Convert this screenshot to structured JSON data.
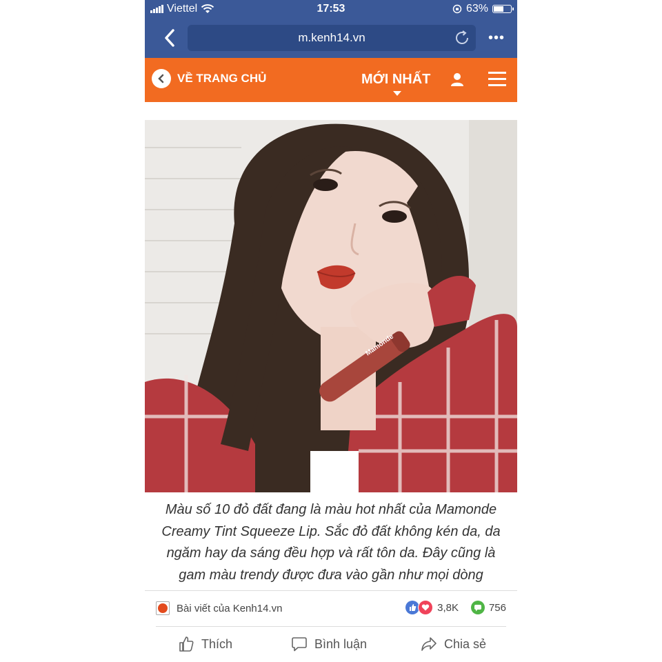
{
  "status_bar": {
    "carrier": "Viettel",
    "time": "17:53",
    "battery_percent": "63%",
    "battery_level": 0.63
  },
  "browser": {
    "url": "m.kenh14.vn"
  },
  "nav": {
    "home_label": "VỀ TRANG CHỦ",
    "newest_label": "MỚI NHẤT"
  },
  "article": {
    "caption": "Màu số 10 đỏ đất đang là màu hot nhất của Mamonde Creamy Tint Squeeze Lip. Sắc đỏ đất không kén da, da ngăm hay da sáng đều hợp và rất tôn da. Đây cũng là gam màu trendy được đưa vào gần như mọi dòng",
    "product_text": "Mamonde"
  },
  "post_meta": {
    "source_label": "Bài viết của Kenh14.vn",
    "reaction_count": "3,8K",
    "comment_count": "756"
  },
  "actions": {
    "like_label": "Thích",
    "comment_label": "Bình luận",
    "share_label": "Chia sẻ"
  },
  "colors": {
    "header_blue": "#3b5998",
    "nav_orange": "#f26b21"
  }
}
